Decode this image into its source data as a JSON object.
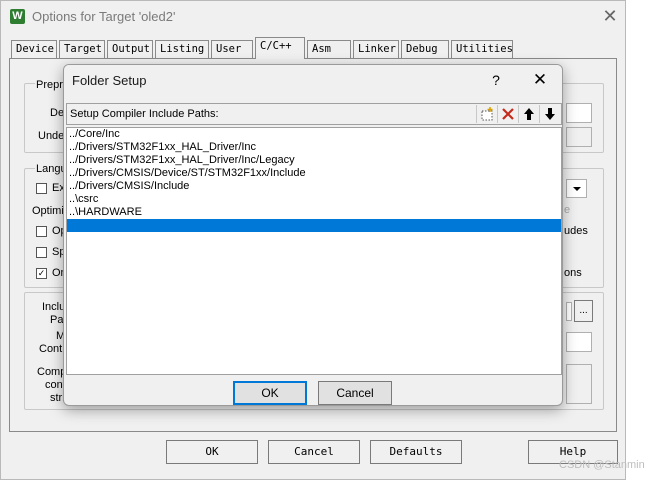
{
  "outer": {
    "title": "Options for Target 'oled2'",
    "icon_glyph": "W",
    "close_glyph": "✕",
    "tabs": [
      "Device",
      "Target",
      "Output",
      "Listing",
      "User",
      "C/C++",
      "Asm",
      "Linker",
      "Debug",
      "Utilities"
    ],
    "active_tab": "C/C++",
    "background_labels": {
      "preproc": "Prepro",
      "define": "Def",
      "undefine": "Unde",
      "language": "Langu",
      "execute": "Ex",
      "optimize": "Optimiz",
      "opt1": "Op",
      "opt2": "Sp",
      "opt3": "On",
      "right1": "e",
      "right2": "udes",
      "right3": "ons",
      "include": "Inclu",
      "paths": "Pat",
      "misc": "M",
      "controls": "Contr",
      "compiler": "Comp",
      "control": "cont",
      "string": "stri",
      "browse": "..."
    },
    "buttons": {
      "ok": "OK",
      "cancel": "Cancel",
      "defaults": "Defaults",
      "help": "Help"
    }
  },
  "folder_setup": {
    "title": "Folder Setup",
    "help_glyph": "?",
    "close_glyph": "✕",
    "header_label": "Setup Compiler Include Paths:",
    "toolbar_icons": [
      "new-folder-icon",
      "delete-icon",
      "move-up-icon",
      "move-down-icon"
    ],
    "paths": [
      "../Core/Inc",
      "../Drivers/STM32F1xx_HAL_Driver/Inc",
      "../Drivers/STM32F1xx_HAL_Driver/Inc/Legacy",
      "../Drivers/CMSIS/Device/ST/STM32F1xx/Include",
      "../Drivers/CMSIS/Include",
      "..\\csrc",
      "..\\HARDWARE",
      ""
    ],
    "selected_index": 7,
    "ok_label": "OK",
    "cancel_label": "Cancel",
    "colors": {
      "selection": "#0078d7",
      "delete_red": "#c42b1c"
    }
  },
  "watermark": "CSDN @Stanmin"
}
